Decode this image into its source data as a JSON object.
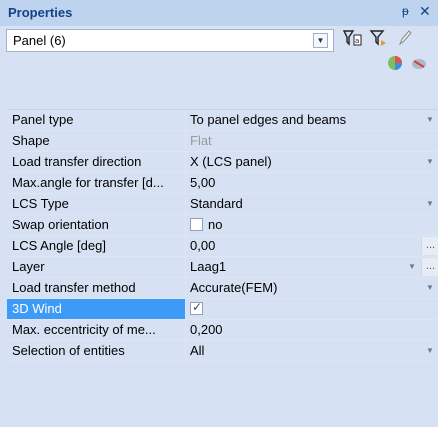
{
  "title_bar": {
    "title": "Properties",
    "pin_icon": "pin-icon",
    "close_icon": "close-icon"
  },
  "selector": {
    "value": "Panel (6)",
    "toolbar_icons": [
      "select-all-filter-icon",
      "filter-icon",
      "edit-pencil-icon"
    ],
    "secondary_icons": [
      "color-palette-icon",
      "pin-remove-icon"
    ]
  },
  "properties": [
    {
      "name": "Panel type",
      "value": "To panel edges and beams",
      "kind": "dropdown"
    },
    {
      "name": "Shape",
      "value": "Flat",
      "kind": "readonly"
    },
    {
      "name": "Load transfer direction",
      "value": "X (LCS panel)",
      "kind": "dropdown"
    },
    {
      "name": "Max.angle for transfer [d...",
      "value": "5,00",
      "kind": "text"
    },
    {
      "name": "LCS Type",
      "value": "Standard",
      "kind": "dropdown"
    },
    {
      "name": "Swap orientation",
      "value": "no",
      "kind": "checkbox",
      "checked": false
    },
    {
      "name": "LCS Angle [deg]",
      "value": "0,00",
      "kind": "ellipsis"
    },
    {
      "name": "Layer",
      "value": "Laag1",
      "kind": "dropdown-ellipsis"
    },
    {
      "name": "Load transfer method",
      "value": "Accurate(FEM)",
      "kind": "dropdown"
    },
    {
      "name": "3D Wind",
      "value": "",
      "kind": "checkbox",
      "checked": true,
      "selected": true
    },
    {
      "name": "Max. eccentricity of me...",
      "value": "0,200",
      "kind": "text"
    },
    {
      "name": "Selection of entities",
      "value": "All",
      "kind": "dropdown"
    }
  ],
  "colors": {
    "title_bg": "#bed3ee",
    "panel_bg": "#d6e2f3",
    "selected_row": "#3d9bf7"
  }
}
